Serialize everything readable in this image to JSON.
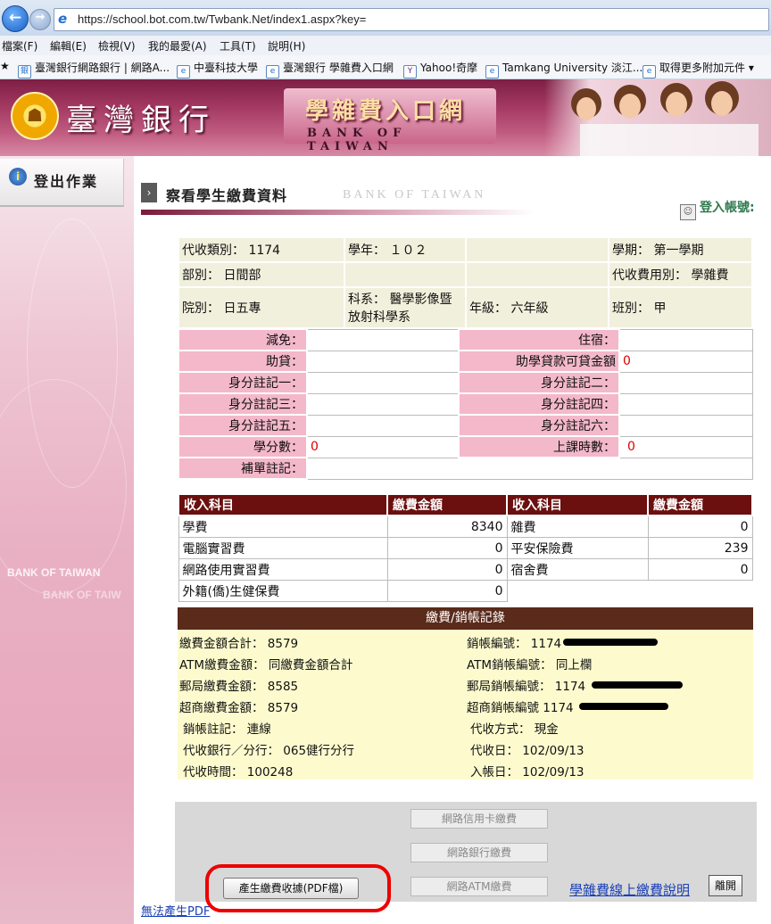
{
  "browser": {
    "url": "https://school.bot.com.tw/Twbank.Net/index1.aspx?key=",
    "menu": [
      "檔案(F)",
      "編輯(E)",
      "檢視(V)",
      "我的最愛(A)",
      "工具(T)",
      "說明(H)"
    ],
    "favorites": [
      "臺灣銀行網路銀行 | 網路A...",
      "中臺科技大學",
      "臺灣銀行 學雜費入口網",
      "Yahoo!奇摩",
      "Tamkang University 淡江...",
      "取得更多附加元件 ▾"
    ]
  },
  "banner": {
    "bank_name": "臺灣銀行",
    "portal_title": "學雜費入口網",
    "portal_sub": "BANK OF TAIWAN"
  },
  "sidebar": {
    "logout_label": "登出作業",
    "watermark": "BANK OF TAIWAN",
    "watermark2": "BANK OF TAIW"
  },
  "header": {
    "title": "察看學生繳費資料",
    "watermark": "BANK OF TAIWAN",
    "login_account": "登入帳號:"
  },
  "info": {
    "collect_type": "代收類別： 1174",
    "school_year": "學年： １０２",
    "semester": "學期： 第一學期",
    "division": "部別： 日間部",
    "fee_use": "代收費用別： 學雜費",
    "college": "院別： 日五專",
    "department": "科系： 醫學影像暨放射科學系",
    "grade": "年級： 六年級",
    "class": "班別： 甲"
  },
  "detail": {
    "reduction": "減免：",
    "lodging": "住宿：",
    "loan": "助貸：",
    "loan_amount": "助學貸款可貸金額",
    "loan_amount_value": "0",
    "id_note1": "身分註記一：",
    "id_note2": "身分註記二：",
    "id_note3": "身分註記三：",
    "id_note4": "身分註記四：",
    "id_note5": "身分註記五：",
    "id_note6": "身分註記六：",
    "credits": "學分數：",
    "credits_value": "0",
    "class_hours": "上課時數：",
    "class_hours_value": "0",
    "supplement_note": "補單註記："
  },
  "fees": {
    "headers": [
      "收入科目",
      "繳費金額",
      "收入科目",
      "繳費金額"
    ],
    "rows": [
      [
        "學費",
        "8340",
        "雜費",
        "0"
      ],
      [
        "電腦實習費",
        "0",
        "平安保險費",
        "239"
      ],
      [
        "網路使用實習費",
        "0",
        "宿舍費",
        "0"
      ],
      [
        "外籍(僑)生健保費",
        "0",
        "",
        ""
      ]
    ]
  },
  "payment_record": {
    "title": "繳費/銷帳記錄",
    "total": "繳費金額合計： 8579",
    "account_no": "銷帳編號： 1174",
    "atm_amount": "ATM繳費金額： 同繳費金額合計",
    "atm_account": "ATM銷帳編號： 同上欄",
    "post_amount": "郵局繳費金額： 8585",
    "post_account": "郵局銷帳編號： 1174",
    "store_amount": "超商繳費金額： 8579",
    "store_account": "超商銷帳編號 1174",
    "cancel_note": "銷帳註記： 連線",
    "collect_method": "代收方式： 現金",
    "collect_bank": "代收銀行／分行： 065健行分行",
    "collect_date": "代收日： 102/09/13",
    "collect_time": "代收時間： 100248",
    "deposit_date": "入帳日： 102/09/13"
  },
  "buttons": {
    "credit_card": "網路信用卡繳費",
    "bank": "網路銀行繳費",
    "atm": "網路ATM繳費",
    "pdf": "產生繳費收據(PDF檔)",
    "help": "學雜費線上繳費說明",
    "leave": "離開",
    "cant_generate": "無法產生PDF"
  },
  "colors": {
    "banner": "#a33861",
    "fee_header": "#6b0f0f",
    "record_header": "#5a2a1a",
    "record_bg": "#fdfbce",
    "label_pink": "#f4b8cb",
    "highlight_circle": "#ee0000"
  }
}
